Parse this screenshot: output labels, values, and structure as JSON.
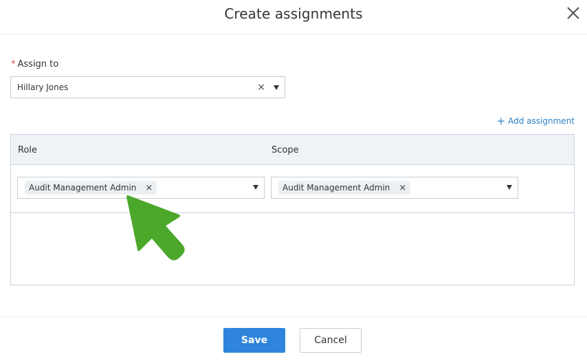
{
  "dialog": {
    "title": "Create assignments",
    "close_icon": "close-icon"
  },
  "assign_to": {
    "required_marker": "*",
    "label": "Assign to",
    "value": "Hillary Jones",
    "clear_glyph": "×"
  },
  "add_assignment": {
    "plus": "+",
    "label": "Add assignment"
  },
  "table": {
    "columns": [
      "Role",
      "Scope"
    ],
    "rows": [
      {
        "role": "Audit Management Admin",
        "scope": "Audit Management Admin"
      }
    ],
    "tag_remove_glyph": "×"
  },
  "footer": {
    "save_label": "Save",
    "cancel_label": "Cancel"
  },
  "colors": {
    "primary": "#2e85db",
    "link": "#2b82c7",
    "header_bg": "#eef3f8",
    "annotation_arrow": "#4ca82a",
    "required": "#d9534f"
  }
}
